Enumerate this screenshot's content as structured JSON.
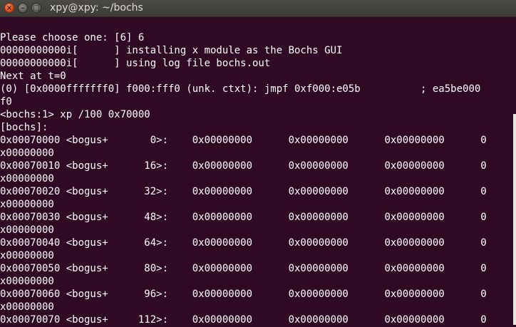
{
  "window": {
    "title": "xpy@xpy: ~/bochs",
    "close_glyph": "×",
    "minimize_glyph": "–",
    "maximize_glyph": "□"
  },
  "terminal": {
    "lines": [
      "Please choose one: [6] 6",
      "00000000000i[      ] installing x module as the Bochs GUI",
      "00000000000i[      ] using log file bochs.out",
      "Next at t=0",
      "(0) [0x0000fffffff0] f000:fff0 (unk. ctxt): jmpf 0xf000:e05b          ; ea5be000",
      "f0",
      "<bochs:1> xp /100 0x70000",
      "[bochs]:",
      "0x00070000 <bogus+       0>:    0x00000000      0x00000000      0x00000000      0",
      "x00000000",
      "0x00070010 <bogus+      16>:    0x00000000      0x00000000      0x00000000      0",
      "x00000000",
      "0x00070020 <bogus+      32>:    0x00000000      0x00000000      0x00000000      0",
      "x00000000",
      "0x00070030 <bogus+      48>:    0x00000000      0x00000000      0x00000000      0",
      "x00000000",
      "0x00070040 <bogus+      64>:    0x00000000      0x00000000      0x00000000      0",
      "x00000000",
      "0x00070050 <bogus+      80>:    0x00000000      0x00000000      0x00000000      0",
      "x00000000",
      "0x00070060 <bogus+      96>:    0x00000000      0x00000000      0x00000000      0",
      "x00000000",
      "0x00070070 <bogus+     112>:    0x00000000      0x00000000      0x00000000      0"
    ]
  },
  "colors": {
    "terminal_background": "#300a24",
    "terminal_text": "#ffffff",
    "close_button": "#df4a16"
  }
}
